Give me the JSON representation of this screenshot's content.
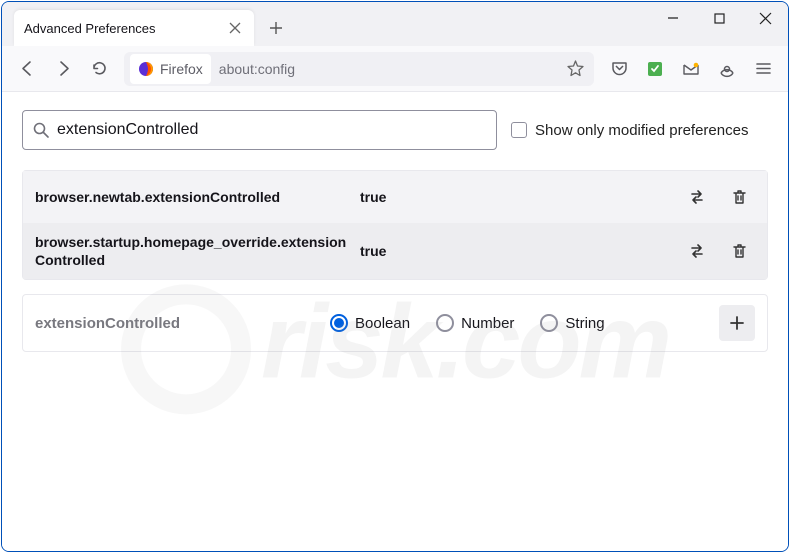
{
  "tab": {
    "title": "Advanced Preferences"
  },
  "address": {
    "brand": "Firefox",
    "url": "about:config"
  },
  "search": {
    "value": "extensionControlled",
    "checkbox_label": "Show only modified preferences"
  },
  "prefs": [
    {
      "name": "browser.newtab.extensionControlled",
      "value": "true"
    },
    {
      "name": "browser.startup.homepage_override.extensionControlled",
      "value": "true"
    }
  ],
  "new_pref": {
    "name": "extensionControlled",
    "types": [
      "Boolean",
      "Number",
      "String"
    ],
    "selected": "Boolean"
  }
}
